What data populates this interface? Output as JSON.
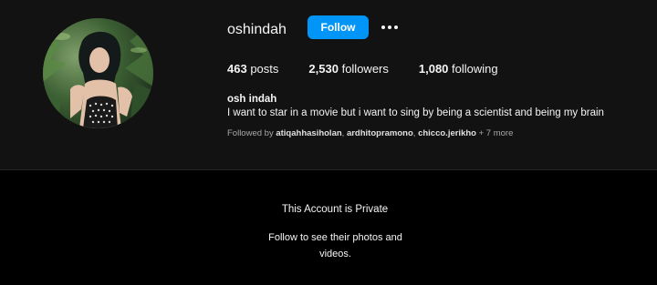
{
  "profile": {
    "username": "oshindah",
    "follow_label": "Follow",
    "more_icon": "more-horizontal-icon",
    "avatar_icon": "profile-photo",
    "stats": {
      "posts_count": "463",
      "posts_label": "posts",
      "followers_count": "2,530",
      "followers_label": "followers",
      "following_count": "1,080",
      "following_label": "following"
    },
    "full_name": "osh indah",
    "bio": "I want to star in a movie but i want to sing by being a scientist and being my brain",
    "followed_by": {
      "prefix": "Followed by ",
      "names": [
        "atiqahhasiholan",
        "ardhitopramono",
        "chicco.jerikho"
      ],
      "more": "+ 7 more"
    }
  },
  "private_notice": {
    "title": "This Account is Private",
    "subtitle": "Follow to see their photos and videos."
  },
  "colors": {
    "header_background": "#121212",
    "page_background": "#000000",
    "follow_button": "#0095f6",
    "secondary_text": "#a8a8a8"
  }
}
